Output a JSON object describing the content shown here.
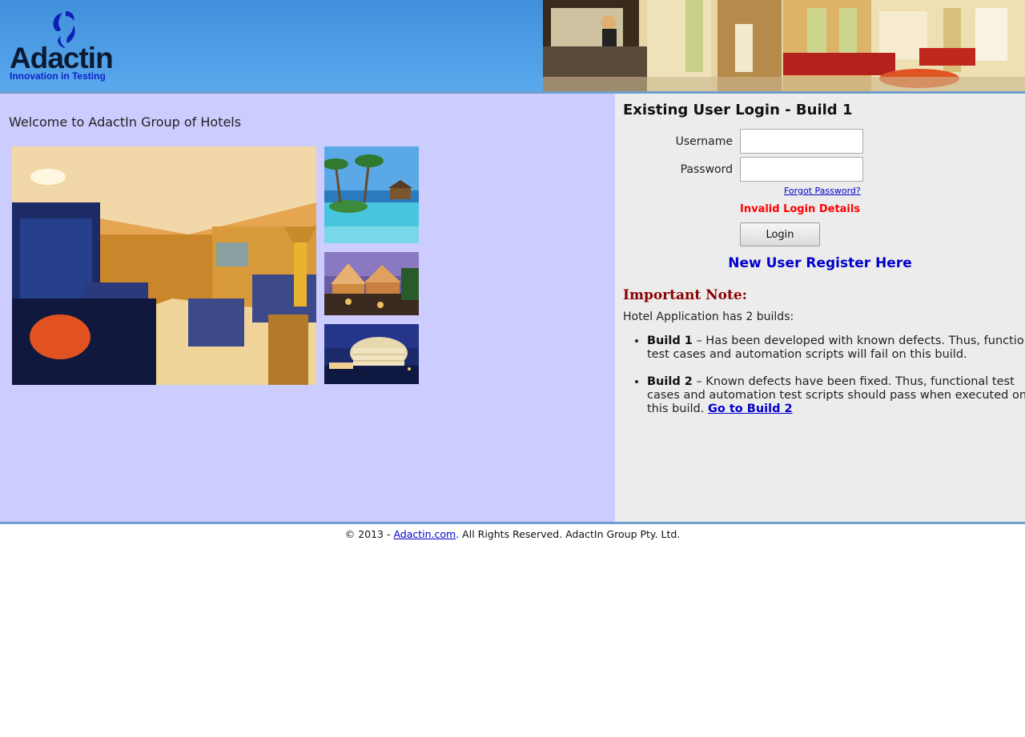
{
  "header": {
    "logo": {
      "name": "Adactin",
      "tagline": "Innovation in Testing",
      "icon": "adactin-logo-icon"
    },
    "banner_image": "hotel-lobby-photo"
  },
  "main": {
    "welcome_text": "Welcome to AdactIn Group of Hotels",
    "photos": [
      "hotel-suite-photo",
      "tropical-pool-photo",
      "resort-tents-photo",
      "hotel-night-photo"
    ]
  },
  "login": {
    "title": "Existing User Login - Build 1",
    "username_label": "Username",
    "username_value": "",
    "password_label": "Password",
    "password_value": "",
    "forgot_password": "Forgot Password?",
    "error_message": "Invalid Login Details",
    "login_button": "Login",
    "register_link": "New User Register Here"
  },
  "note": {
    "heading": "Important Note:",
    "intro": "Hotel Application has 2 builds:",
    "builds": [
      {
        "name": "Build 1",
        "text": " – Has been developed with known defects. Thus, functional test cases and automation scripts will fail on this build."
      },
      {
        "name": "Build 2",
        "text": " – Known defects have been fixed. Thus, functional test cases and automation test scripts should pass when executed on this build. ",
        "link": "Go to Build 2"
      }
    ]
  },
  "footer": {
    "prefix": "© 2013 - ",
    "link": "Adactin.com",
    "suffix": ". All Rights Reserved. AdactIn Group Pty. Ltd."
  },
  "colors": {
    "header_blue": "#4a9be6",
    "left_panel": "#ccccff",
    "right_panel": "#ececec",
    "error_red": "#ff0000",
    "link_blue": "#0000cc",
    "note_red": "#8b0000"
  }
}
